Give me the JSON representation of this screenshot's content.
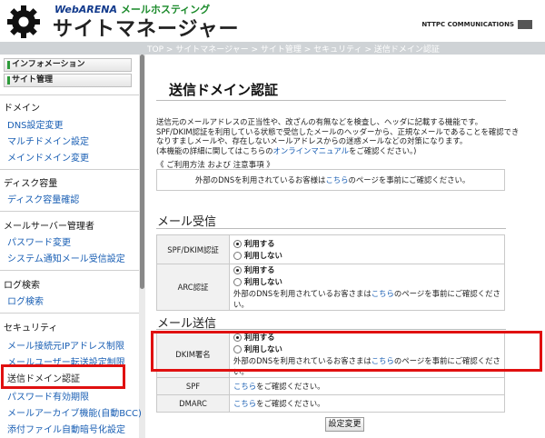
{
  "header": {
    "brand_top": "WebARENA",
    "brand_sub": "メールホスティング",
    "title": "サイトマネージャー",
    "ntt": "NTTPC COMMUNICATIONS"
  },
  "breadcrumb": "TOP > サイトマネージャー > サイト管理 > セキュリティ > 送信ドメイン認証",
  "sidebar": {
    "top_buttons": [
      "インフォメーション",
      "サイト管理"
    ],
    "sections": [
      {
        "title": "ドメイン",
        "items": [
          "DNS設定変更",
          "マルチドメイン設定",
          "メインドメイン変更"
        ]
      },
      {
        "title": "ディスク容量",
        "items": [
          "ディスク容量確認"
        ]
      },
      {
        "title": "メールサーバー管理者",
        "items": [
          "パスワード変更",
          "システム通知メール受信設定"
        ]
      },
      {
        "title": "ログ検索",
        "items": [
          "ログ検索"
        ]
      },
      {
        "title": "セキュリティ",
        "items": [
          "メール接続元IPアドレス制限",
          "メールユーザー転送設定制限",
          "送信ドメイン認証",
          "パスワード有効期限",
          "メールアーカイブ機能(自動BCC)",
          "添付ファイル自動暗号化設定"
        ]
      }
    ]
  },
  "main": {
    "page_title": "送信ドメイン認証",
    "intro_lines": [
      "送信元のメールアドレスの正当性や、改ざんの有無などを検査し、ヘッダに記載する機能です。",
      "SPF/DKIM認証を利用している状態で受信したメールのヘッダーから、正規なメールであることを確認でき",
      "なりすましメールや、存在しないメールアドレスからの迷惑メールなどの対策になります。"
    ],
    "intro_last_pre": "(本機能の詳細に関してはこちらの",
    "intro_link": "オンラインマニュアル",
    "intro_last_post": "をご確認ください。)",
    "terms_head": "《 ご利用方法 および 注意事項 》",
    "terms_pre": "外部のDNSを利用されているお客様は",
    "terms_link": "こちら",
    "terms_post": "のページを事前にご確認ください。",
    "receive_title": "メール受信",
    "send_title": "メール送信",
    "opt_on": "利用する",
    "opt_off": "利用しない",
    "note_pre": "外部のDNSを利用されているお客さまは",
    "note_link": "こちら",
    "note_post": "のページを事前にご確認ください。",
    "rows_receive": [
      {
        "label": "SPF/DKIM認証",
        "selected": "on"
      },
      {
        "label": "ARC認証",
        "selected": "on"
      }
    ],
    "rows_send": [
      {
        "label": "DKIM署名",
        "selected": "on"
      },
      {
        "label": "SPF"
      },
      {
        "label": "DMARC"
      }
    ],
    "link_confirm_pre": "こちら",
    "link_confirm_post": "をご確認ください。",
    "submit": "設定変更"
  }
}
